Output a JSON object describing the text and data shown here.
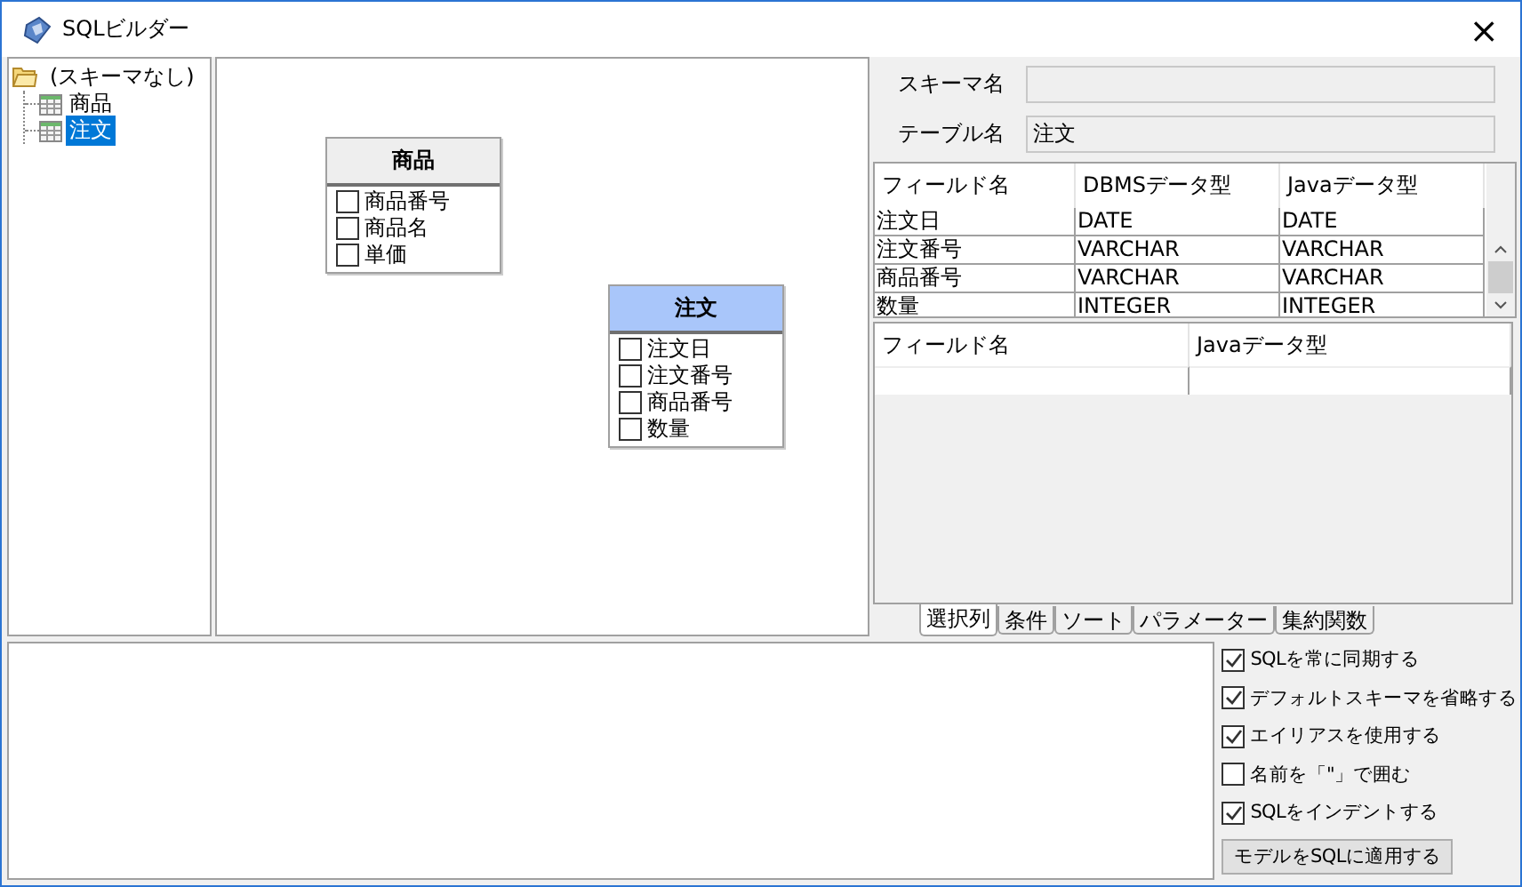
{
  "window": {
    "title": "SQLビルダー",
    "close": "×"
  },
  "tree": {
    "label": "(スキーマなし)",
    "expanded": true,
    "children": [
      {
        "label": "商品",
        "selected": false
      },
      {
        "label": "注文",
        "selected": true
      }
    ]
  },
  "canvas_tables": [
    {
      "name": "商品",
      "selected": false,
      "fields": [
        {
          "label": "商品番号",
          "checked": false
        },
        {
          "label": "商品名",
          "checked": false
        },
        {
          "label": "単価",
          "checked": false
        }
      ]
    },
    {
      "name": "注文",
      "selected": true,
      "fields": [
        {
          "label": "注文日",
          "checked": false
        },
        {
          "label": "注文番号",
          "checked": false
        },
        {
          "label": "商品番号",
          "checked": false
        },
        {
          "label": "数量",
          "checked": false
        }
      ]
    }
  ],
  "schema": {
    "label": "スキーマ名"
  },
  "table_name": {
    "label": "テーブル名",
    "value": "注文"
  },
  "fields_grid": {
    "columns": [
      "フィールド名",
      "DBMSデータ型",
      "Javaデータ型"
    ],
    "rows": [
      [
        "注文日",
        "DATE",
        "DATE"
      ],
      [
        "注文番号",
        "VARCHAR",
        "VARCHAR"
      ],
      [
        "商品番号",
        "VARCHAR",
        "VARCHAR"
      ],
      [
        "数量",
        "INTEGER",
        "INTEGER"
      ]
    ]
  },
  "selected_grid": {
    "columns": [
      "フィールド名",
      "Javaデータ型"
    ]
  },
  "tabs": [
    {
      "label": "選択列",
      "selected": true
    },
    {
      "label": "条件",
      "selected": false
    },
    {
      "label": "ソート",
      "selected": false
    },
    {
      "label": "パラメーター",
      "selected": false
    },
    {
      "label": "集約関数",
      "selected": false
    }
  ],
  "options": [
    {
      "label": "SQLを常に同期する",
      "checked": true
    },
    {
      "label": "デフォルトスキーマを省略する",
      "checked": true
    },
    {
      "label": "エイリアスを使用する",
      "checked": true
    },
    {
      "label": "名前を「\"」で囲む",
      "checked": false
    },
    {
      "label": "SQLをインデントする",
      "checked": true
    }
  ],
  "apply_button": "モデルをSQLに適用する"
}
